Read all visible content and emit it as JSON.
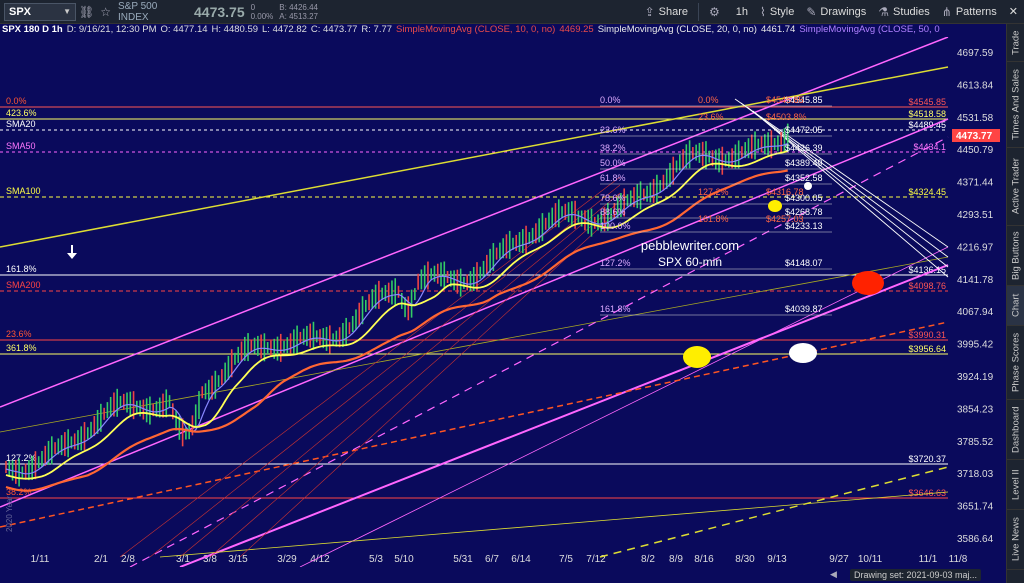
{
  "toolbar": {
    "symbol": "SPX",
    "index_name": "S&P 500 INDEX",
    "price": "4473.75",
    "change_top": "0",
    "change_pct": "0.00%",
    "bid": "B: 4426.44",
    "ask": "A: 4513.27",
    "share": "Share",
    "interval": "1h",
    "style": "Style",
    "drawings": "Drawings",
    "studies": "Studies",
    "patterns": "Patterns"
  },
  "legend": {
    "title": "SPX 180 D 1h",
    "date": "D: 9/16/21, 12:30 PM",
    "open": "O: 4477.14",
    "high": "H: 4480.59",
    "low": "L: 4472.82",
    "close": "C: 4473.77",
    "range": "R: 7.77",
    "sma10": "SimpleMovingAvg (CLOSE, 10, 0, no)",
    "sma10_val": "4469.25",
    "sma20": "SimpleMovingAvg (CLOSE, 20, 0, no)",
    "sma20_val": "4461.74",
    "sma50": "SimpleMovingAvg (CLOSE, 50, 0, ..."
  },
  "side_tabs": [
    "Trade",
    "Times And Sales",
    "Active Trader",
    "Big Buttons",
    "Chart",
    "Phase Scores",
    "Dashboard",
    "Level II",
    "Live News"
  ],
  "footer": {
    "drawing_set": "Drawing set: 2021-09-03 maj..."
  },
  "chart": {
    "watermark": "pebblewriter.com",
    "subtitle": "SPX 60-min",
    "side_watermark": "2020 Year",
    "price_ticks": [
      "4697.59",
      "4613.84",
      "4531.58",
      "4450.79",
      "4371.44",
      "4293.51",
      "4216.97",
      "4141.78",
      "4067.94",
      "3995.42",
      "3924.19",
      "3854.23",
      "3785.52",
      "3718.03",
      "3651.74",
      "3586.64"
    ],
    "date_ticks": [
      "1/11",
      "2/1",
      "2/8",
      "3/1",
      "3/8",
      "3/15",
      "3/29",
      "4/12",
      "5/3",
      "5/10",
      "5/31",
      "6/7",
      "6/14",
      "7/5",
      "7/12",
      "8/2",
      "8/9",
      "8/16",
      "8/30",
      "9/13",
      "9/27",
      "10/11",
      "11/1",
      "11/8"
    ],
    "current_price": "4473.77",
    "left_labels": [
      {
        "text": "0.0%",
        "color": "#ff5533"
      },
      {
        "text": "423.6%",
        "color": "#ffff66"
      },
      {
        "text": "SMA20",
        "color": "#ffffff"
      },
      {
        "text": "SMA50",
        "color": "#ff77ff"
      },
      {
        "text": "SMA100",
        "color": "#ffff44"
      },
      {
        "text": "161.8%",
        "color": "#ffffff"
      },
      {
        "text": "SMA200",
        "color": "#ff4444"
      },
      {
        "text": "23.6%",
        "color": "#ff5533"
      },
      {
        "text": "361.8%",
        "color": "#ffff66"
      },
      {
        "text": "127.2%",
        "color": "#ffffff"
      },
      {
        "text": "38.2%",
        "color": "#ff5533"
      }
    ],
    "right_labels": [
      {
        "text": "$4545.85",
        "color": "#ff5555"
      },
      {
        "text": "$4518.58",
        "color": "#ffff66"
      },
      {
        "text": "$4489.45",
        "color": "#ffffff"
      },
      {
        "text": "$4434.1",
        "color": "#ff77ff"
      },
      {
        "text": "$4324.45",
        "color": "#ffff44"
      },
      {
        "text": "$4136.15",
        "color": "#ffffff"
      },
      {
        "text": "$4098.76",
        "color": "#ff5555"
      },
      {
        "text": "$3990.31",
        "color": "#ff5555"
      },
      {
        "text": "$3956.64",
        "color": "#ffff66"
      },
      {
        "text": "$3720.37",
        "color": "#ffffff"
      },
      {
        "text": "$3646.63",
        "color": "#ff5555"
      }
    ],
    "fib_purple": [
      {
        "pct": "0.0%",
        "val": "$4545.85"
      },
      {
        "pct": "23.6%",
        "val": "$4472.05"
      },
      {
        "pct": "38.2%",
        "val": "$4426.39"
      },
      {
        "pct": "50.0%",
        "val": "$4389.49"
      },
      {
        "pct": "61.8%",
        "val": "$4352.58"
      },
      {
        "pct": "78.6%",
        "val": "$4300.05"
      },
      {
        "pct": "88.6%",
        "val": "$4268.78"
      },
      {
        "pct": "100.0%",
        "val": "$4233.13"
      },
      {
        "pct": "127.2%",
        "val": "$4148.07"
      },
      {
        "pct": "161.8%",
        "val": "$4039.87"
      }
    ],
    "fib_red": [
      {
        "pct": "0.0%",
        "val": "$4545.85"
      },
      {
        "pct": "23.6%",
        "val": "$4503.8%"
      },
      {
        "pct": "127.2%",
        "val": "$4316.78"
      },
      {
        "pct": "161.8%",
        "val": "$4257.03"
      }
    ]
  }
}
